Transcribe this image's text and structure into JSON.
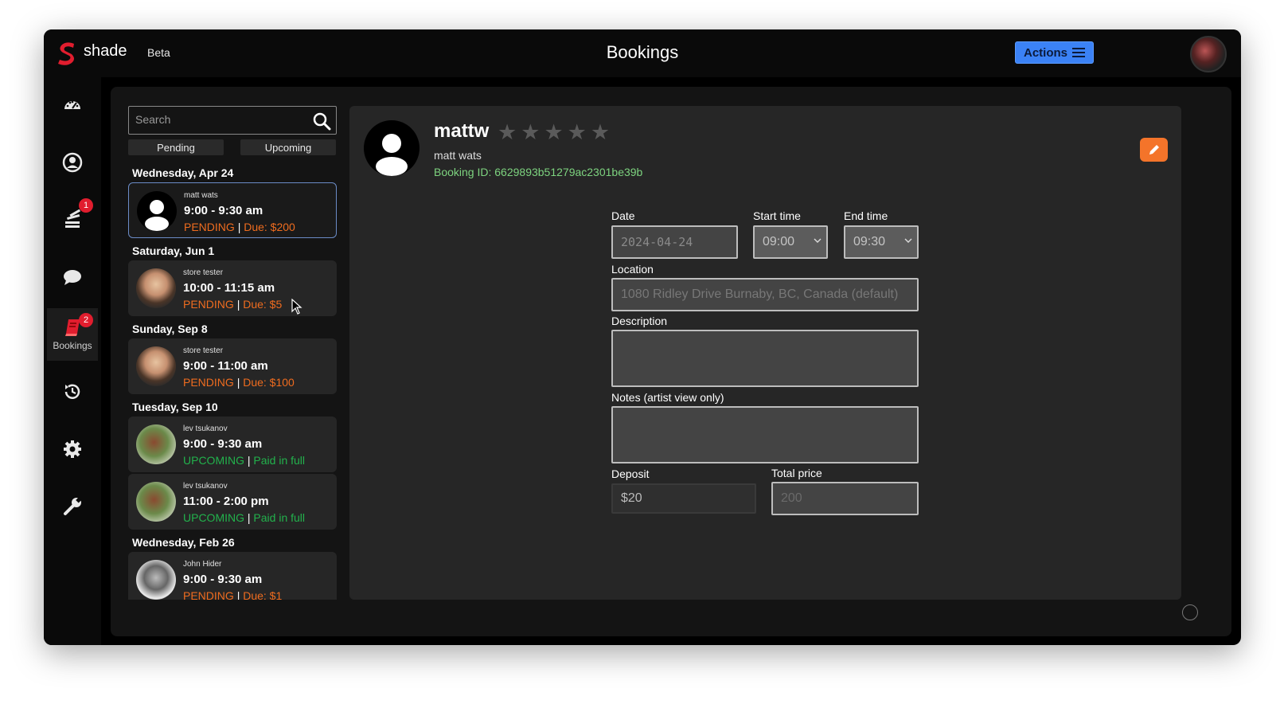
{
  "app": {
    "brand": "shade",
    "beta_label": "Beta",
    "page_title": "Bookings",
    "actions_label": "Actions"
  },
  "sidebar": {
    "items": [
      {
        "icon": "dashboard-icon"
      },
      {
        "icon": "user-icon"
      },
      {
        "icon": "stack-icon",
        "badge": "1"
      },
      {
        "icon": "chat-icon"
      },
      {
        "icon": "book-icon",
        "badge": "2",
        "label": "Bookings"
      },
      {
        "icon": "history-icon"
      },
      {
        "icon": "gear-icon"
      },
      {
        "icon": "wrench-icon"
      }
    ]
  },
  "list": {
    "search_placeholder": "Search",
    "filters": [
      "Pending",
      "Upcoming"
    ],
    "days": [
      "Wednesday, Apr 24",
      "Saturday, Jun 1",
      "Sunday, Sep 8",
      "Tuesday, Sep 10",
      "Wednesday, Feb 26"
    ],
    "bookings": [
      {
        "name": "matt wats",
        "time": "9:00 - 9:30 am",
        "status": "PENDING",
        "payment": "Due: $200"
      },
      {
        "name": "store tester",
        "time": "10:00 - 11:15 am",
        "status": "PENDING",
        "payment": "Due: $5"
      },
      {
        "name": "store tester",
        "time": "9:00 - 11:00 am",
        "status": "PENDING",
        "payment": "Due: $100"
      },
      {
        "name": "lev tsukanov",
        "time": "9:00 - 9:30 am",
        "status": "UPCOMING",
        "payment": "Paid in full"
      },
      {
        "name": "lev tsukanov",
        "time": "11:00 - 2:00 pm",
        "status": "UPCOMING",
        "payment": "Paid in full"
      },
      {
        "name": "John Hider",
        "time": "9:00 - 9:30 am",
        "status": "PENDING",
        "payment": "Due: $1"
      }
    ],
    "separator": "|"
  },
  "detail": {
    "username": "mattw",
    "rating": 0,
    "full_name": "matt wats",
    "booking_id": "Booking ID: 6629893b51279ac2301be39b",
    "form": {
      "date_label": "Date",
      "date_value": "2024-04-24",
      "start_label": "Start time",
      "start_value": "09:00",
      "end_label": "End time",
      "end_value": "09:30",
      "location_label": "Location",
      "location_value": "1080 Ridley Drive Burnaby, BC, Canada (default)",
      "description_label": "Description",
      "description_value": "",
      "notes_label": "Notes (artist view only)",
      "notes_value": "",
      "deposit_label": "Deposit",
      "deposit_value": "$20",
      "total_label": "Total price",
      "total_value": "200"
    }
  },
  "colors": {
    "pending": "#ef6c1f",
    "upcoming": "#22b24c",
    "booking_id": "#7dd37f",
    "accent": "#3b82f6",
    "edit": "#f4742a",
    "badge": "#e11d2e"
  }
}
